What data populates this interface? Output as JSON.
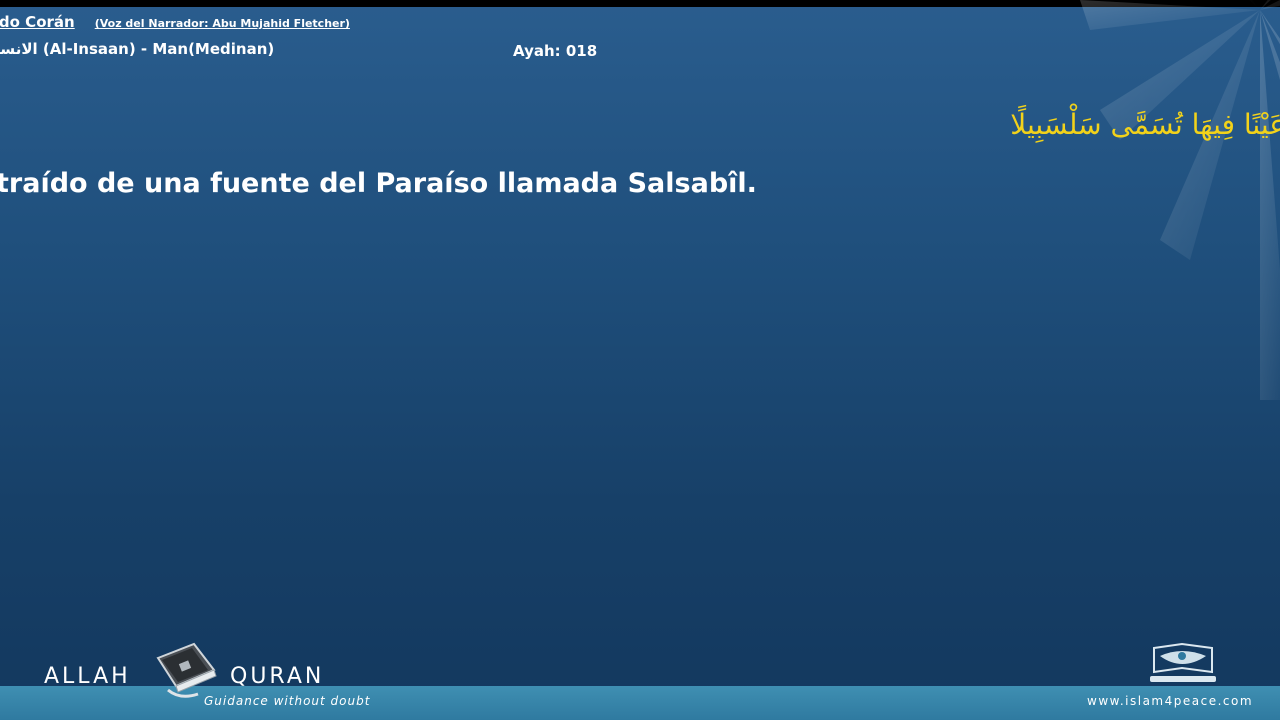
{
  "header": {
    "title": "rrado Corán",
    "narrator": "(Voz del Narrador: Abu Mujahid Fletcher)",
    "surah": "الانسان (Al-Insaan) - Man(Medinan)",
    "ayah": "Ayah: 018"
  },
  "verse": {
    "arabic": "عَيْنًا فِيهَا تُسَمَّى سَلْسَبِيلًا",
    "translation": "traído de una fuente del Paraíso llamada Salsabîl."
  },
  "footer": {
    "logo_left": "ALLAH",
    "logo_right": "QURAN",
    "tagline": "Guidance without doubt",
    "site_url": "www.islam4peace.com",
    "book_icon": "quran-book-icon",
    "site_icon": "open-book-logo-icon"
  },
  "colors": {
    "background": "#1f4f7c",
    "arabic_text": "#f2d21a",
    "footer_band": "#3f8fb2"
  }
}
